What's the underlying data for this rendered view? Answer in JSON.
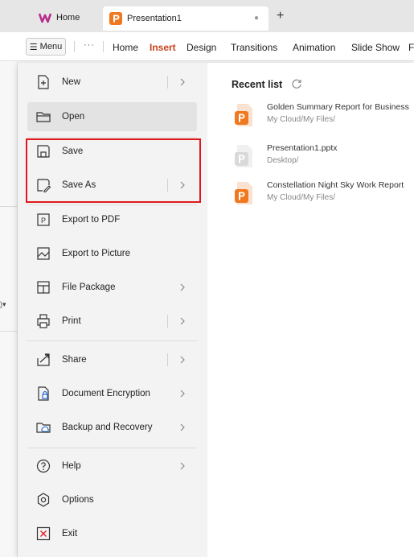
{
  "tabs": {
    "home_label": "Home",
    "doc_label": "Presentation1",
    "new_tab": "+"
  },
  "ribbon": {
    "menu_label": "Menu",
    "more": "···",
    "tabs": [
      "Home",
      "Insert",
      "Design",
      "Transitions",
      "Animation",
      "Slide Show",
      "F"
    ],
    "active_tab": "Insert"
  },
  "left_fragment": ")▾",
  "menu": {
    "items": [
      {
        "label": "New",
        "icon": "new-file-icon",
        "submenu": true
      },
      {
        "label": "Open",
        "icon": "folder-open-icon",
        "submenu": false
      },
      {
        "label": "Save",
        "icon": "save-icon",
        "submenu": false
      },
      {
        "label": "Save As",
        "icon": "save-as-icon",
        "submenu": true
      },
      {
        "label": "Export to PDF",
        "icon": "export-pdf-icon",
        "submenu": false
      },
      {
        "label": "Export to Picture",
        "icon": "export-picture-icon",
        "submenu": false
      },
      {
        "label": "File Package",
        "icon": "file-package-icon",
        "submenu": true
      },
      {
        "label": "Print",
        "icon": "print-icon",
        "submenu": true
      },
      {
        "label": "Share",
        "icon": "share-icon",
        "submenu": true
      },
      {
        "label": "Document Encryption",
        "icon": "lock-icon",
        "submenu": true
      },
      {
        "label": "Backup and Recovery",
        "icon": "cloud-backup-icon",
        "submenu": true
      },
      {
        "label": "Help",
        "icon": "help-icon",
        "submenu": true
      },
      {
        "label": "Options",
        "icon": "gear-icon",
        "submenu": false
      },
      {
        "label": "Exit",
        "icon": "close-icon",
        "submenu": false
      }
    ]
  },
  "recent": {
    "title": "Recent list",
    "items": [
      {
        "name": "Golden Summary Report for Business",
        "path": "My Cloud/My Files/",
        "icon_color": "#f0781e"
      },
      {
        "name": "Presentation1.pptx",
        "path": "Desktop/",
        "icon_color": "#d9d9d9"
      },
      {
        "name": "Constellation Night Sky Work Report",
        "path": "My Cloud/My Files/",
        "icon_color": "#f0781e"
      }
    ]
  },
  "colors": {
    "accent": "#c8431c",
    "highlight_box": "#e0181e",
    "ppt_orange": "#f0781e"
  }
}
